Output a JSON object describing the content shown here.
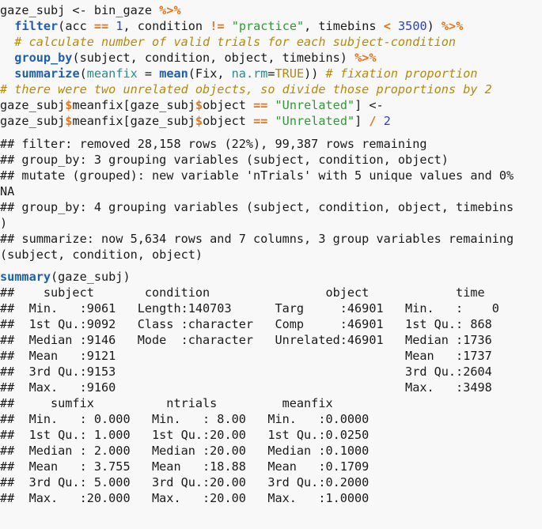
{
  "document": {
    "kind": "r-code-console-transcript",
    "background_color": "#f8f8f9",
    "text_color": "#1a1a1a"
  },
  "palette": {
    "function": "#1f5fa9",
    "operator": "#e8751a",
    "number": "#2b3fd0",
    "string": "#2e9a33",
    "comment": "#b5890b",
    "argument": "#2a8a8a",
    "constant": "#b5890b"
  },
  "code_block_1": {
    "lines": [
      {
        "id": "l1",
        "tokens": [
          {
            "t": "gaze_subj <- bin_gaze ",
            "c": "plain"
          },
          {
            "t": "%>%",
            "c": "op"
          }
        ]
      },
      {
        "id": "l2",
        "tokens": [
          {
            "t": "  ",
            "c": "plain"
          },
          {
            "t": "filter",
            "c": "fn"
          },
          {
            "t": "(acc ",
            "c": "plain"
          },
          {
            "t": "==",
            "c": "op"
          },
          {
            "t": " ",
            "c": "plain"
          },
          {
            "t": "1",
            "c": "num"
          },
          {
            "t": ", condition ",
            "c": "plain"
          },
          {
            "t": "!=",
            "c": "op"
          },
          {
            "t": " ",
            "c": "plain"
          },
          {
            "t": "\"practice\"",
            "c": "str"
          },
          {
            "t": ", timebins ",
            "c": "plain"
          },
          {
            "t": "<",
            "c": "op"
          },
          {
            "t": " ",
            "c": "plain"
          },
          {
            "t": "3500",
            "c": "num"
          },
          {
            "t": ") ",
            "c": "plain"
          },
          {
            "t": "%>%",
            "c": "op"
          }
        ]
      },
      {
        "id": "l3",
        "tokens": [
          {
            "t": "  # calculate number of valid trials for each subject-condition",
            "c": "com"
          }
        ]
      },
      {
        "id": "l4",
        "tokens": [
          {
            "t": "  ",
            "c": "plain"
          },
          {
            "t": "group_by",
            "c": "fn"
          },
          {
            "t": "(subject, condition, object, timebins) ",
            "c": "plain"
          },
          {
            "t": "%>%",
            "c": "op"
          }
        ]
      },
      {
        "id": "l5",
        "tokens": [
          {
            "t": "  ",
            "c": "plain"
          },
          {
            "t": "summarize",
            "c": "fn"
          },
          {
            "t": "(",
            "c": "plain"
          },
          {
            "t": "meanfix",
            "c": "arg"
          },
          {
            "t": " = ",
            "c": "plain"
          },
          {
            "t": "mean",
            "c": "fn"
          },
          {
            "t": "(Fix, ",
            "c": "plain"
          },
          {
            "t": "na.rm",
            "c": "arg"
          },
          {
            "t": "=",
            "c": "plain"
          },
          {
            "t": "TRUE",
            "c": "const"
          },
          {
            "t": ")) ",
            "c": "plain"
          },
          {
            "t": "# fixation proportion",
            "c": "com"
          }
        ]
      },
      {
        "id": "l6",
        "tokens": [
          {
            "t": "# there were two unrelated objects, so divide those proportions by 2",
            "c": "com"
          }
        ]
      },
      {
        "id": "l7",
        "tokens": [
          {
            "t": "gaze_subj",
            "c": "plain"
          },
          {
            "t": "$",
            "c": "dollar"
          },
          {
            "t": "meanfix[gaze_subj",
            "c": "plain"
          },
          {
            "t": "$",
            "c": "dollar"
          },
          {
            "t": "object ",
            "c": "plain"
          },
          {
            "t": "==",
            "c": "op"
          },
          {
            "t": " ",
            "c": "plain"
          },
          {
            "t": "\"Unrelated\"",
            "c": "str"
          },
          {
            "t": "] <-",
            "c": "plain"
          }
        ]
      },
      {
        "id": "l8",
        "tokens": [
          {
            "t": "gaze_subj",
            "c": "plain"
          },
          {
            "t": "$",
            "c": "dollar"
          },
          {
            "t": "meanfix[gaze_subj",
            "c": "plain"
          },
          {
            "t": "$",
            "c": "dollar"
          },
          {
            "t": "object ",
            "c": "plain"
          },
          {
            "t": "==",
            "c": "op"
          },
          {
            "t": " ",
            "c": "plain"
          },
          {
            "t": "\"Unrelated\"",
            "c": "str"
          },
          {
            "t": "] ",
            "c": "plain"
          },
          {
            "t": "/",
            "c": "op"
          },
          {
            "t": " ",
            "c": "plain"
          },
          {
            "t": "2",
            "c": "num"
          }
        ]
      }
    ]
  },
  "output_block_1": {
    "lines": [
      "## filter: removed 28,158 rows (22%), 99,387 rows remaining",
      "## group_by: 3 grouping variables (subject, condition, object)",
      "## mutate (grouped): new variable 'nTrials' with 5 unique values and 0%",
      "NA",
      "## group_by: 4 grouping variables (subject, condition, object, timebins",
      ")",
      "## summarize: now 5,634 rows and 7 columns, 3 group variables remaining",
      "(subject, condition, object)"
    ]
  },
  "code_block_2": {
    "lines": [
      {
        "id": "s1",
        "tokens": [
          {
            "t": "summary",
            "c": "fn"
          },
          {
            "t": "(gaze_subj)",
            "c": "plain"
          }
        ]
      }
    ]
  },
  "output_block_2": {
    "lines": [
      "##    subject       condition                object            time     ",
      "##  Min.   :9061   Length:140703      Targ     :46901   Min.   :    0  ",
      "##  1st Qu.:9092   Class :character   Comp     :46901   1st Qu.: 868   ",
      "##  Median :9146   Mode  :character   Unrelated:46901   Median :1736   ",
      "##  Mean   :9121                                        Mean   :1737   ",
      "##  3rd Qu.:9153                                        3rd Qu.:2604   ",
      "##  Max.   :9160                                        Max.   :3498   ",
      "##     sumfix          ntrials         meanfix      ",
      "##  Min.   : 0.000   Min.   : 8.00   Min.   :0.0000  ",
      "##  1st Qu.: 1.000   1st Qu.:20.00   1st Qu.:0.0250  ",
      "##  Median : 2.000   Median :20.00   Median :0.1000  ",
      "##  Mean   : 3.755   Mean   :18.88   Mean   :0.1709  ",
      "##  3rd Qu.: 5.000   3rd Qu.:20.00   3rd Qu.:0.2000  ",
      "##  Max.   :20.000   Max.   :20.00   Max.   :1.0000  "
    ]
  }
}
